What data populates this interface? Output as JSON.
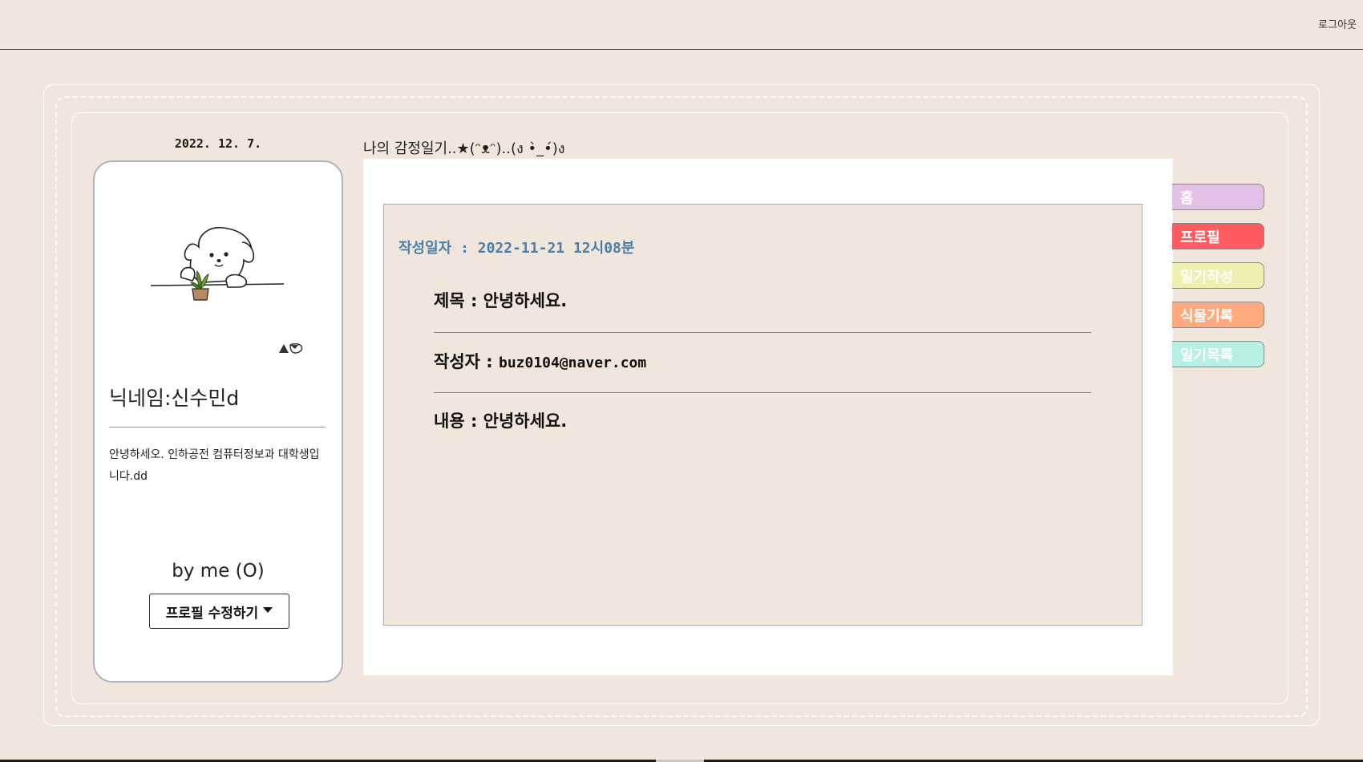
{
  "header": {
    "logout_label": "로그아웃"
  },
  "date": "2022. 12. 7.",
  "diary_title": "나의 감정일기..★(ᵔᴥᵔ)..(ง •̀_•́)ง",
  "profile": {
    "nickname": "닉네임:신수민d",
    "bio": "안녕하세오. 인하공전 컴퓨터정보과 대학생입니다.dd",
    "by_me": "by me (O)",
    "edit_button_label": "프로필 수정하기"
  },
  "entry": {
    "written_date": "작성일자 : 2022-11-21 12시08분",
    "title_label": "제목 : ",
    "title_value": "안녕하세요.",
    "author_label": "작성자 : ",
    "author_value": "buz0104@naver.com",
    "content_label": "내용 : ",
    "content_value": "안녕하세요."
  },
  "nav_tabs": [
    {
      "label": "홈",
      "color": "#e3c1e7"
    },
    {
      "label": "프로필",
      "color": "#ff5a5f"
    },
    {
      "label": "일기작성",
      "color": "#eef0b1"
    },
    {
      "label": "식물기록",
      "color": "#ffa97f"
    },
    {
      "label": "일기목록",
      "color": "#b8efe3"
    }
  ],
  "colors": {
    "background": "#f1e6dc",
    "accent_blue": "#4a7fa8",
    "card_border": "#aab6c4"
  }
}
